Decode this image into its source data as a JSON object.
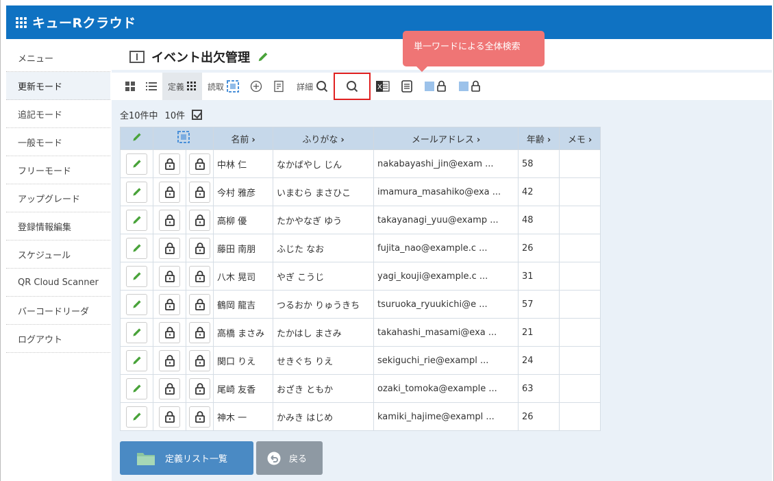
{
  "header": {
    "title": "キューRクラウド",
    "bg_color": "#0f72c2"
  },
  "sidebar": {
    "items": [
      {
        "label": "メニュー"
      },
      {
        "label": "更新モード",
        "active": true
      },
      {
        "label": "追記モード"
      },
      {
        "label": "一般モード"
      },
      {
        "label": "フリーモード"
      },
      {
        "label": "アップグレード"
      },
      {
        "label": "登録情報編集"
      },
      {
        "label": "スケジュール"
      },
      {
        "label": "QR Cloud Scanner"
      },
      {
        "label": "バーコードリーダ"
      },
      {
        "label": "ログアウト"
      }
    ]
  },
  "page": {
    "title": "イベント出欠管理"
  },
  "toolbar": {
    "define_label": "定義",
    "read_label": "読取",
    "detail_label": "詳細",
    "tooltip": "単一ワードによる全体検索",
    "highlight_color": "#e02020"
  },
  "summary": {
    "total": "全10件中",
    "shown": "10件"
  },
  "table": {
    "headers": {
      "name": "名前",
      "kana": "ふりがな",
      "email": "メールアドレス",
      "age": "年齢",
      "memo": "メモ"
    },
    "rows": [
      {
        "name": "中林 仁",
        "kana": "なかばやし じん",
        "email": "nakabayashi_jin@exam ...",
        "age": "58",
        "memo": ""
      },
      {
        "name": "今村 雅彦",
        "kana": "いまむら まさひこ",
        "email": "imamura_masahiko@exa ...",
        "age": "42",
        "memo": ""
      },
      {
        "name": "高柳 優",
        "kana": "たかやなぎ ゆう",
        "email": "takayanagi_yuu@examp ...",
        "age": "48",
        "memo": ""
      },
      {
        "name": "藤田 南朋",
        "kana": "ふじた なお",
        "email": "fujita_nao@example.c ...",
        "age": "26",
        "memo": ""
      },
      {
        "name": "八木 晃司",
        "kana": "やぎ こうじ",
        "email": "yagi_kouji@example.c ...",
        "age": "31",
        "memo": ""
      },
      {
        "name": "鶴岡 龍吉",
        "kana": "つるおか りゅうきち",
        "email": "tsuruoka_ryuukichi@e ...",
        "age": "57",
        "memo": ""
      },
      {
        "name": "高橋 まさみ",
        "kana": "たかはし まさみ",
        "email": "takahashi_masami@exa ...",
        "age": "21",
        "memo": ""
      },
      {
        "name": "関口 りえ",
        "kana": "せきぐち りえ",
        "email": "sekiguchi_rie@exampl ...",
        "age": "24",
        "memo": ""
      },
      {
        "name": "尾崎 友香",
        "kana": "おざき ともか",
        "email": "ozaki_tomoka@example ...",
        "age": "63",
        "memo": ""
      },
      {
        "name": "神木 一",
        "kana": "かみき はじめ",
        "email": "kamiki_hajime@exampl ...",
        "age": "26",
        "memo": ""
      }
    ]
  },
  "buttons": {
    "define_list": "定義リスト一覧",
    "back": "戻る"
  }
}
